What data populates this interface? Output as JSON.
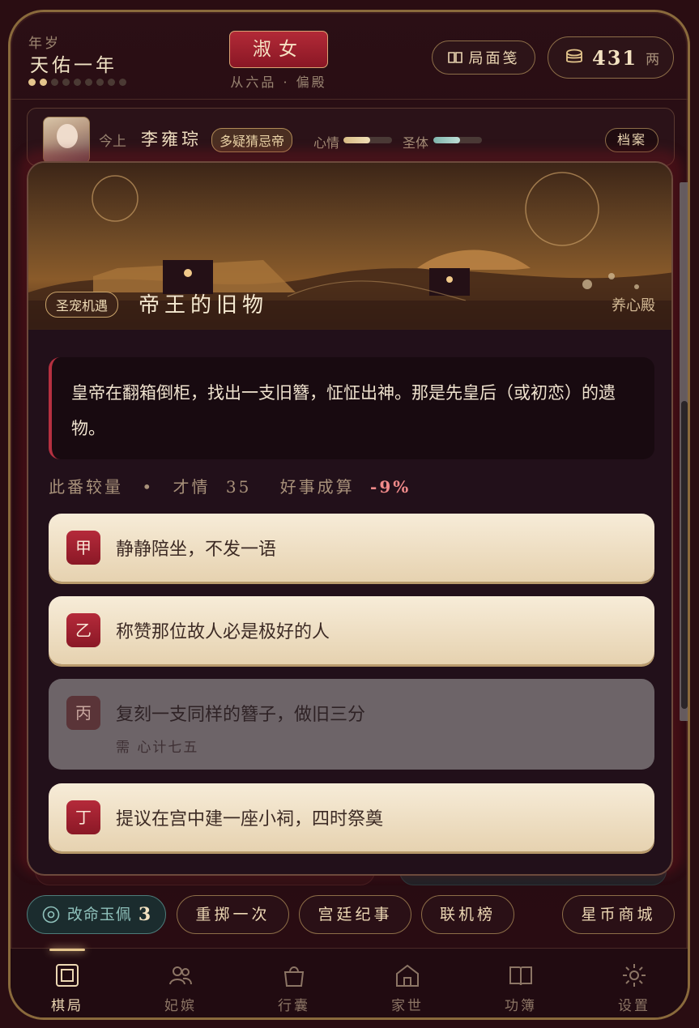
{
  "header": {
    "year_label": "年岁",
    "year_value": "天佑一年",
    "progress_dots": {
      "filled": 2,
      "total": 9
    },
    "rank": "淑女",
    "rank_sub": "从六品 · 偏殿",
    "layout_button": "局面笺",
    "coins": "431",
    "coin_unit": "两"
  },
  "emperor": {
    "prefix": "今上",
    "name": "李雍琮",
    "trait": "多疑猜忌帝",
    "mood_label": "心情",
    "mood_level": 0.55,
    "health_label": "圣体",
    "health_level": 0.55,
    "file_button": "档案",
    "colors": {
      "mood": "#d9bd86",
      "health": "#7fb6ad"
    }
  },
  "event": {
    "tag": "圣宠机遇",
    "title": "帝王的旧物",
    "place": "养心殿",
    "narration": "皇帝在翻箱倒柜，找出一支旧簪，怔怔出神。那是先皇后（或初恋）的遗物。",
    "compare": {
      "label": "此番较量",
      "sep": "•",
      "stat": "才情",
      "stat_value": "35",
      "odds_label": "好事成算",
      "odds_value": "-9%"
    },
    "choices": [
      {
        "seal": "甲",
        "text": "静静陪坐，不发一语",
        "enabled": true
      },
      {
        "seal": "乙",
        "text": "称赞那位故人必是极好的人",
        "enabled": true
      },
      {
        "seal": "丙",
        "text": "复刻一支同样的簪子，做旧三分",
        "requirement": "需 心计七五",
        "enabled": false
      },
      {
        "seal": "丁",
        "text": "提议在宫中建一座小祠，四时祭奠",
        "enabled": true
      }
    ]
  },
  "actions": {
    "jade": "改命玉佩",
    "jade_count": "3",
    "reroll": "重掷一次",
    "chronicle": "宫廷纪事",
    "leaderboard": "联机榜",
    "shop": "星币商城"
  },
  "nav": [
    {
      "label": "棋局",
      "icon": "board-icon",
      "active": true
    },
    {
      "label": "妃嫔",
      "icon": "people-icon",
      "active": false
    },
    {
      "label": "行囊",
      "icon": "bag-icon",
      "active": false
    },
    {
      "label": "家世",
      "icon": "house-icon",
      "active": false
    },
    {
      "label": "功簿",
      "icon": "book-icon",
      "active": false
    },
    {
      "label": "设置",
      "icon": "gear-icon",
      "active": false
    }
  ]
}
